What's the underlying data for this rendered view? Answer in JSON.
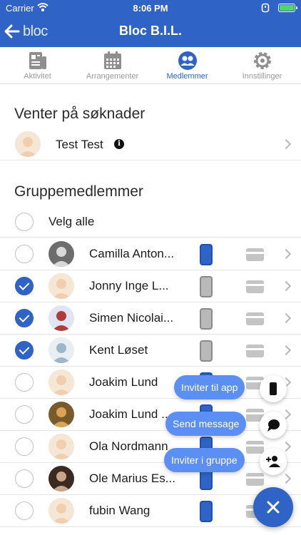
{
  "status_bar": {
    "carrier": "Carrier",
    "time": "8:06 PM"
  },
  "nav": {
    "brand": "bloc",
    "title": "Bloc B.I.L."
  },
  "tabs": [
    {
      "label": "Aktivitet",
      "icon": "newspaper-icon",
      "active": false
    },
    {
      "label": "Arrangementer",
      "icon": "calendar-icon",
      "active": false
    },
    {
      "label": "Medlemmer",
      "icon": "members-icon",
      "active": true
    },
    {
      "label": "Innstillinger",
      "icon": "gear-icon",
      "active": false
    }
  ],
  "pending": {
    "title": "Venter på søknader",
    "items": [
      {
        "name": "Test Test",
        "info_icon": "info-icon"
      }
    ]
  },
  "members": {
    "title": "Gruppemedlemmer",
    "select_all": "Velg alle",
    "rows": [
      {
        "name": "Camilla Anton...",
        "checked": false,
        "app_installed": true
      },
      {
        "name": "Jonny Inge L...",
        "checked": true,
        "app_installed": false
      },
      {
        "name": "Simen Nicolai...",
        "checked": true,
        "app_installed": false
      },
      {
        "name": "Kent Løset",
        "checked": true,
        "app_installed": false
      },
      {
        "name": "Joakim Lund",
        "checked": false,
        "app_installed": true
      },
      {
        "name": "Joakim Lund ...",
        "checked": false,
        "app_installed": true
      },
      {
        "name": "Ola Nordmann",
        "checked": false,
        "app_installed": true
      },
      {
        "name": "Ole Marius Es...",
        "checked": false,
        "app_installed": true
      },
      {
        "name": "fubin Wang",
        "checked": false,
        "app_installed": true
      }
    ]
  },
  "fab_menu": {
    "invite_app": "Inviter til app",
    "send_message": "Send message",
    "invite_group": "Inviter i gruppe"
  },
  "colors": {
    "accent": "#2f63c5",
    "fab_label": "#5b8ff3",
    "battery": "#4cd964"
  }
}
